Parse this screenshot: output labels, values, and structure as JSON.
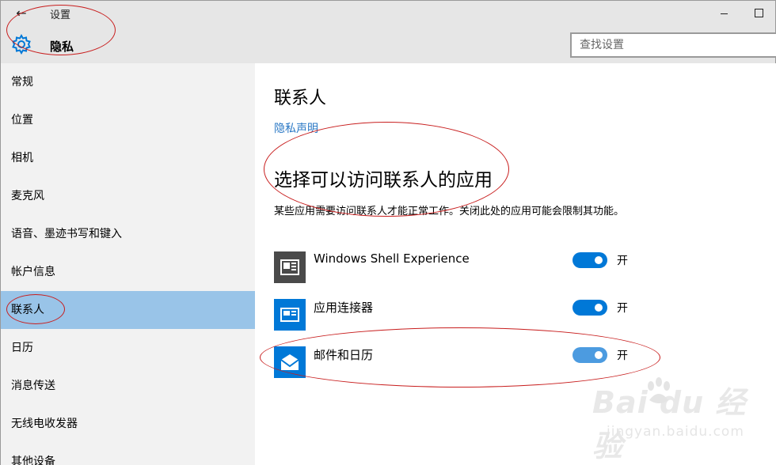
{
  "window": {
    "back_icon": "←",
    "title": "设置",
    "header": "隐私",
    "header_icon": "gear-icon"
  },
  "search": {
    "placeholder": "查找设置"
  },
  "sidebar": {
    "items": [
      {
        "label": "常规",
        "active": false
      },
      {
        "label": "位置",
        "active": false
      },
      {
        "label": "相机",
        "active": false
      },
      {
        "label": "麦克风",
        "active": false
      },
      {
        "label": "语音、墨迹书写和键入",
        "active": false
      },
      {
        "label": "帐户信息",
        "active": false
      },
      {
        "label": "联系人",
        "active": true
      },
      {
        "label": "日历",
        "active": false
      },
      {
        "label": "消息传送",
        "active": false
      },
      {
        "label": "无线电收发器",
        "active": false
      },
      {
        "label": "其他设备",
        "active": false
      }
    ]
  },
  "main": {
    "title": "联系人",
    "privacy_link": "隐私声明",
    "subtitle": "选择可以访问联系人的应用",
    "description": "某些应用需要访问联系人才能正常工作。关闭此处的应用可能会限制其功能。",
    "apps": [
      {
        "name": "Windows Shell Experience",
        "state": "开",
        "on": true,
        "icon": "windows-shell-icon"
      },
      {
        "name": "应用连接器",
        "state": "开",
        "on": true,
        "icon": "app-connector-icon"
      },
      {
        "name": "邮件和日历",
        "state": "开",
        "on": true,
        "icon": "mail-calendar-icon"
      }
    ]
  },
  "watermark": {
    "brand": "Bai du 经验",
    "url": "jingyan.baidu.com"
  },
  "colors": {
    "accent": "#0078d7",
    "link": "#2a78c5",
    "selected": "#99c4e8",
    "annotation": "#c81e1e"
  }
}
